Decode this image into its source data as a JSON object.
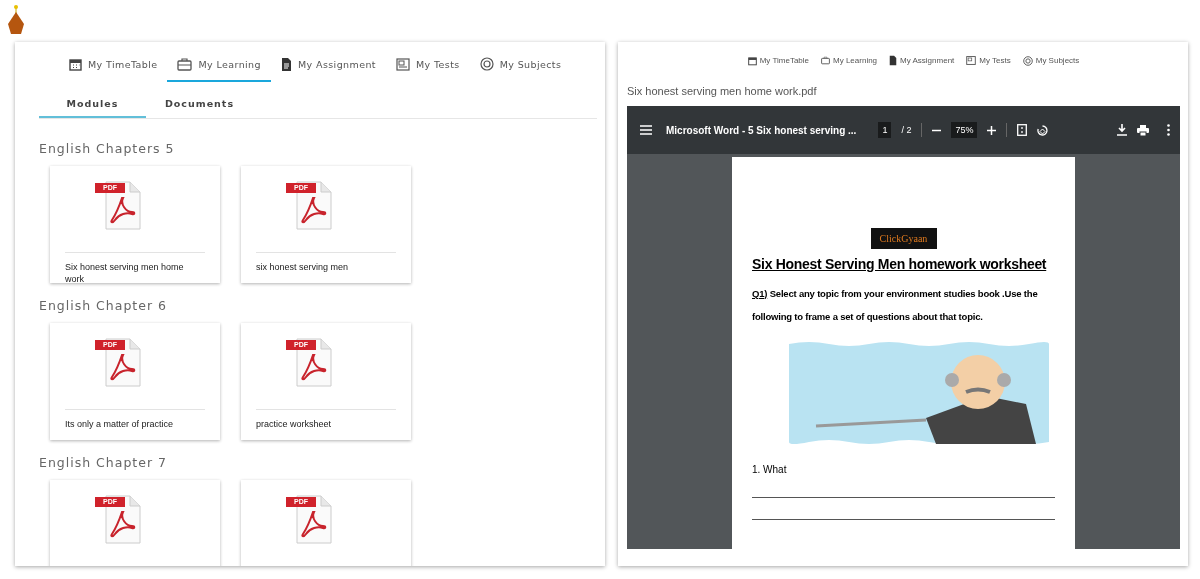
{
  "left_panel": {
    "tabs": [
      {
        "label": "My TimeTable",
        "selected": false
      },
      {
        "label": "My Learning",
        "selected": true
      },
      {
        "label": "My Assignment",
        "selected": false
      },
      {
        "label": "My Tests",
        "selected": false
      },
      {
        "label": "My Subjects",
        "selected": false
      }
    ],
    "subtabs": [
      {
        "label": "Modules",
        "selected": true
      },
      {
        "label": "Documents",
        "selected": false
      }
    ],
    "sections": [
      {
        "heading": "English Chapters 5",
        "files": [
          {
            "badge": "PDF",
            "title": "Six honest serving men home work"
          },
          {
            "badge": "PDF",
            "title": "six honest serving men"
          }
        ]
      },
      {
        "heading": "English Chapter 6",
        "files": [
          {
            "badge": "PDF",
            "title": "Its only a matter of practice"
          },
          {
            "badge": "PDF",
            "title": "practice worksheet"
          }
        ]
      },
      {
        "heading": "English Chapter 7",
        "files": [
          {
            "badge": "PDF"
          },
          {
            "badge": "PDF"
          }
        ]
      }
    ]
  },
  "right_panel": {
    "tabs": [
      "My TimeTable",
      "My Learning",
      "My Assignment",
      "My Tests",
      "My Subjects"
    ],
    "file_name": "Six honest serving men home work.pdf",
    "viewer": {
      "title": "Microsoft Word - 5 Six honest serving ...",
      "page": "1",
      "page_total": "/ 2",
      "zoom": "75%",
      "document": {
        "logo": "ClickGyaan",
        "title": "Six Honest Serving Men  homework worksheet",
        "question_number": "Q1)",
        "question": "Select any topic from your environment studies book .Use the following to frame a set of questions about that topic.",
        "item": "1. What"
      }
    }
  }
}
